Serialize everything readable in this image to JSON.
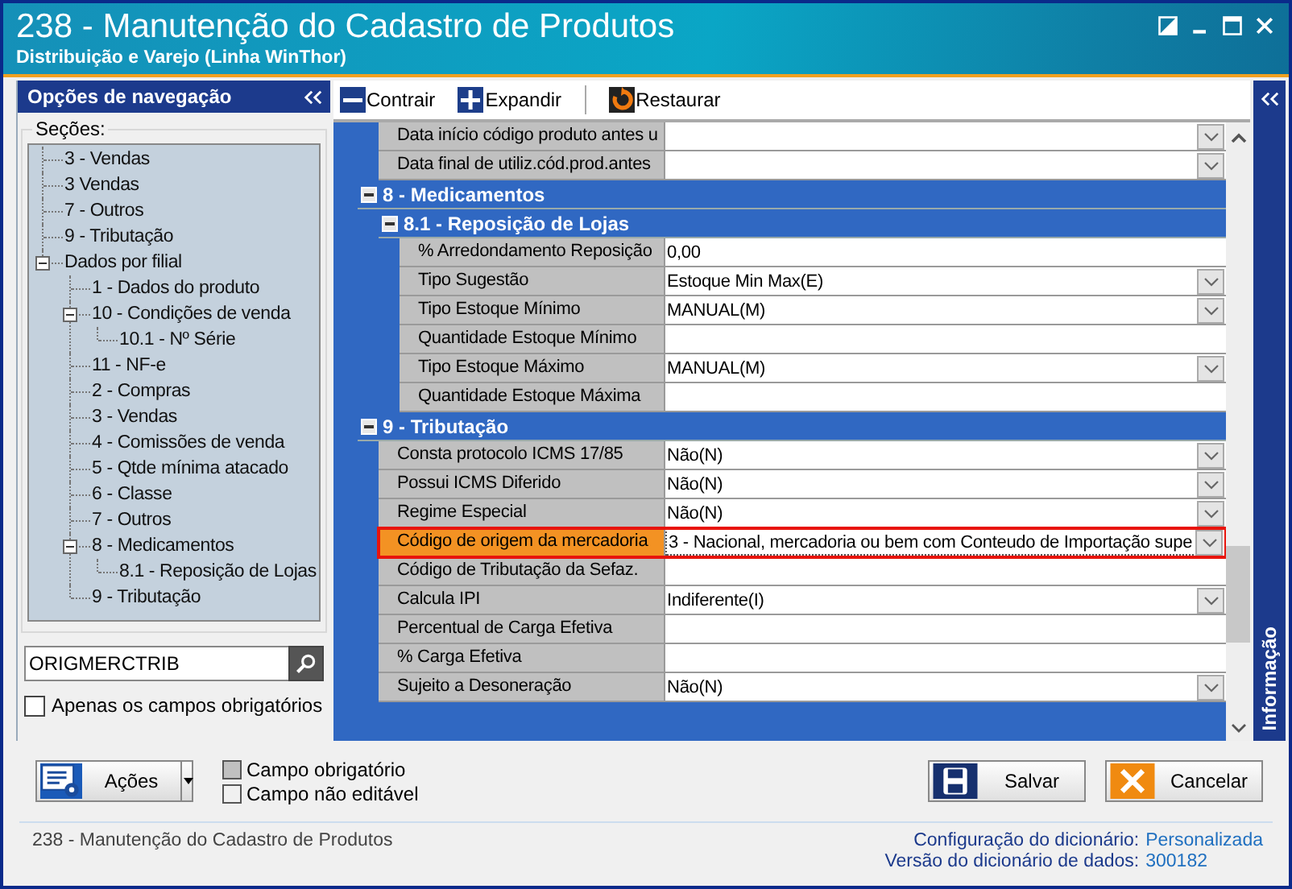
{
  "window": {
    "title": "238 - Manutenção do Cadastro de Produtos",
    "subtitle": "Distribuição e Varejo (Linha WinThor)"
  },
  "nav": {
    "header": "Opções de navegação",
    "sections_label": "Seções:",
    "tree": [
      {
        "label": "3 - Vendas"
      },
      {
        "label": "3 Vendas"
      },
      {
        "label": "7 - Outros"
      },
      {
        "label": "9 - Tributação"
      },
      {
        "label": "Dados por filial",
        "expanded": true,
        "children": [
          {
            "label": "1 - Dados do produto"
          },
          {
            "label": "10 - Condições de venda",
            "expanded": true,
            "children": [
              {
                "label": "10.1 - Nº Série"
              }
            ]
          },
          {
            "label": "11 - NF-e"
          },
          {
            "label": "2 - Compras"
          },
          {
            "label": "3 - Vendas"
          },
          {
            "label": "4 - Comissões de venda"
          },
          {
            "label": "5 - Qtde mínima atacado"
          },
          {
            "label": "6 - Classe"
          },
          {
            "label": "7 - Outros"
          },
          {
            "label": "8 - Medicamentos",
            "expanded": true,
            "children": [
              {
                "label": "8.1 -  Reposição de Lojas"
              }
            ]
          },
          {
            "label": "9 - Tributação"
          }
        ]
      }
    ],
    "search": {
      "value": "ORIGMERCTRIB"
    },
    "only_required": {
      "label": "Apenas os campos obrigatórios",
      "checked": false
    }
  },
  "toolbar": [
    {
      "label": "Contrair",
      "kind": "collapse"
    },
    {
      "label": "Expandir",
      "kind": "expand"
    },
    {
      "label": "Restaurar",
      "kind": "restore"
    }
  ],
  "grid": [
    {
      "kind": "continued",
      "children": [
        {
          "kind": "field",
          "label": "Data início código produto antes u",
          "dropdown": true,
          "selected": false
        },
        {
          "kind": "field",
          "label": "Data final de utiliz.cód.prod.antes",
          "dropdown": true,
          "selected": false
        }
      ]
    },
    {
      "kind": "section",
      "title": "8 - Medicamentos",
      "expanded": true,
      "children": [
        {
          "kind": "section",
          "title": "8.1 -  Reposição de Lojas",
          "expanded": true,
          "children": [
            {
              "kind": "field",
              "label": "% Arredondamento Reposição",
              "value": "0,00",
              "dropdown": false,
              "selected": false
            },
            {
              "kind": "field",
              "label": "Tipo Sugestão",
              "value": "Estoque Min Max(E)",
              "dropdown": true,
              "selected": false
            },
            {
              "kind": "field",
              "label": "Tipo Estoque Mínimo",
              "value": "MANUAL(M)",
              "dropdown": true,
              "selected": false
            },
            {
              "kind": "field",
              "label": "Quantidade Estoque Mínimo",
              "dropdown": false,
              "selected": false
            },
            {
              "kind": "field",
              "label": "Tipo Estoque Máximo",
              "value": "MANUAL(M)",
              "dropdown": true,
              "selected": false
            },
            {
              "kind": "field",
              "label": "Quantidade Estoque Máxima",
              "dropdown": false,
              "selected": false
            }
          ]
        }
      ]
    },
    {
      "kind": "section",
      "title": "9 - Tributação",
      "expanded": true,
      "children": [
        {
          "kind": "field",
          "label": "Consta protocolo ICMS 17/85",
          "value": "Não(N)",
          "dropdown": true,
          "selected": false
        },
        {
          "kind": "field",
          "label": "Possui ICMS Diferido",
          "value": "Não(N)",
          "dropdown": true,
          "selected": false
        },
        {
          "kind": "field",
          "label": "Regime Especial",
          "value": "Não(N)",
          "dropdown": true,
          "selected": false
        },
        {
          "kind": "field",
          "label": "Código de origem da mercadoria",
          "value": "3 - Nacional, mercadoria ou bem com Conteudo de Importação supe",
          "dropdown": true,
          "selected": true
        },
        {
          "kind": "field",
          "label": "Código de Tributação da Sefaz.",
          "dropdown": false,
          "selected": false
        },
        {
          "kind": "field",
          "label": "Calcula IPI",
          "value": "Indiferente(I)",
          "dropdown": true,
          "selected": false
        },
        {
          "kind": "field",
          "label": "Percentual de Carga Efetiva",
          "dropdown": false,
          "selected": false
        },
        {
          "kind": "field",
          "label": "%  Carga Efetiva",
          "dropdown": false,
          "selected": false
        },
        {
          "kind": "field",
          "label": "Sujeito a Desoneração",
          "value": "Não(N)",
          "dropdown": true,
          "selected": false
        }
      ]
    }
  ],
  "info_panel": {
    "label": "Informação"
  },
  "actions": {
    "label": "Ações"
  },
  "legend": [
    {
      "label": "Campo obrigatório",
      "color": "#c0c0c0"
    },
    {
      "label": "Campo não editável",
      "color": "#f0f0f0"
    }
  ],
  "buttons": [
    {
      "label": "Salvar",
      "kind": "save"
    },
    {
      "label": "Cancelar",
      "kind": "cancel"
    }
  ],
  "status_bar": {
    "text": "238 - Manutenção do Cadastro de Produtos",
    "entries": [
      {
        "label": "Configuração do dicionário:",
        "value": "Personalizada"
      },
      {
        "label": "Versão do dicionário de dados:",
        "value": "300182"
      }
    ]
  }
}
